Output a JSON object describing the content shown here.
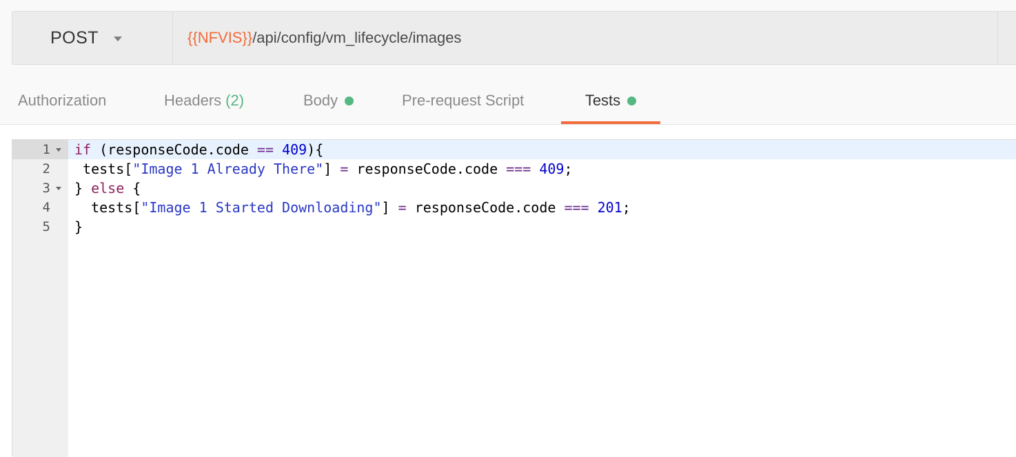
{
  "request": {
    "method": "POST",
    "url_variable": "{{NFVIS}}",
    "url_path": "/api/config/vm_lifecycle/images"
  },
  "tabs": [
    {
      "label": "Authorization"
    },
    {
      "label": "Headers",
      "count": "(2)"
    },
    {
      "label": "Body"
    },
    {
      "label": "Pre-request Script"
    },
    {
      "label": "Tests",
      "active": true
    }
  ],
  "editor": {
    "lines": [
      {
        "number": "1",
        "text": "if (responseCode.code == 409){"
      },
      {
        "number": "2",
        "text": " tests[\"Image 1 Already There\"] = responseCode.code === 409;"
      },
      {
        "number": "3",
        "text": "} else {"
      },
      {
        "number": "4",
        "text": "  tests[\"Image 1 Started Downloading\"] = responseCode.code === 201;"
      },
      {
        "number": "5",
        "text": "}"
      }
    ]
  },
  "colors": {
    "accent": "#f26b3a",
    "indicator_dot": "#56b881"
  }
}
